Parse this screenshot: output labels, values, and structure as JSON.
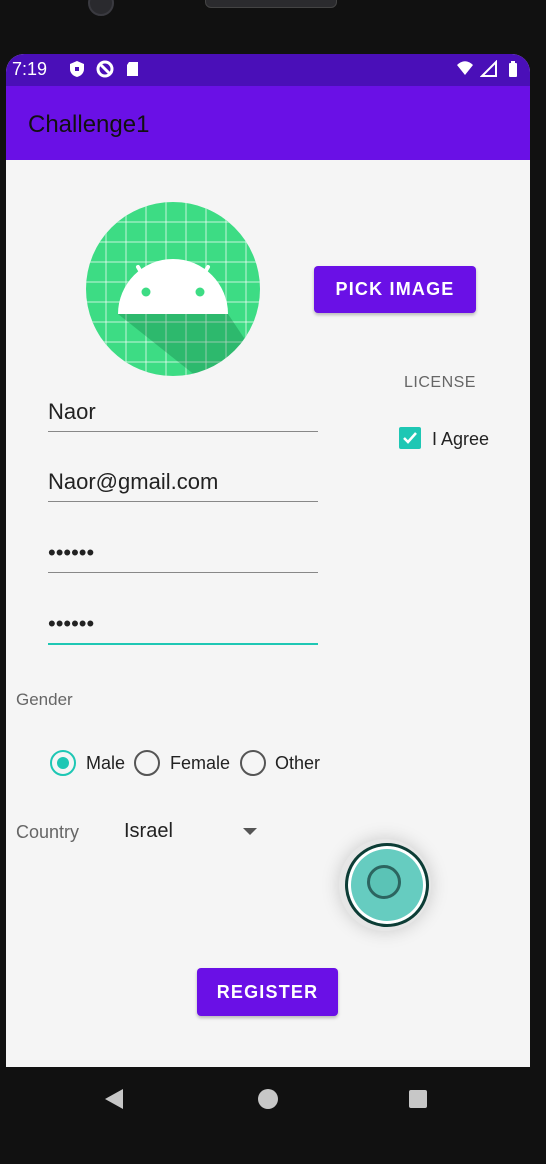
{
  "status_bar": {
    "time": "7:19",
    "left_icons": [
      "shield-icon",
      "do-not-disturb-icon",
      "sd-card-icon"
    ],
    "right_icons": [
      "wifi-icon",
      "signal-icon",
      "battery-icon"
    ]
  },
  "app_bar": {
    "title": "Challenge1",
    "color": "#6a10e6",
    "status_color": "#4a0fb8"
  },
  "avatar": {
    "icon": "android-logo-icon"
  },
  "buttons": {
    "pick_image": "PICK IMAGE",
    "register": "REGISTER"
  },
  "license": {
    "label": "LICENSE",
    "checkbox_label": "I Agree",
    "checked": true
  },
  "form": {
    "name": "Naor",
    "email": "Naor@gmail.com",
    "password": "••••••",
    "confirm_password": "••••••"
  },
  "gender": {
    "label": "Gender",
    "options": [
      "Male",
      "Female",
      "Other"
    ],
    "selected": "Male"
  },
  "country": {
    "label": "Country",
    "selected": "Israel"
  },
  "accent_color": "#1ec7b4",
  "nav_bar": {
    "icons": [
      "back-icon",
      "home-icon",
      "recents-icon"
    ]
  }
}
